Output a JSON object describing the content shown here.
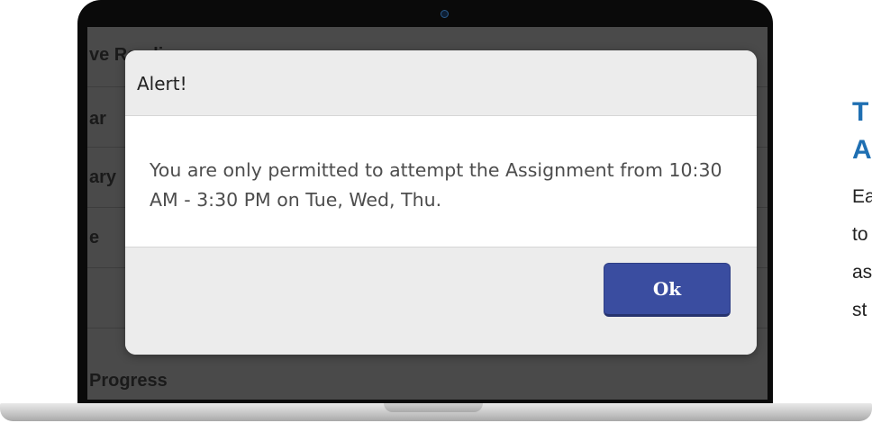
{
  "background_screen": {
    "rows": [
      "ve Readin",
      "ar",
      "ary",
      "e",
      "",
      "Progress"
    ]
  },
  "dialog": {
    "title": "Alert!",
    "message": "You are only permitted to attempt the Assignment from 10:30 AM - 3:30 PM on Tue, Wed, Thu.",
    "ok_label": "Ok"
  },
  "side_panel": {
    "heading_line1": "T",
    "heading_line2": "A",
    "text_lines": [
      "Ea",
      "to",
      "as",
      "st"
    ]
  },
  "colors": {
    "accent": "#3a4da0",
    "heading": "#1f6fb2",
    "dialog_chrome": "#ececec",
    "screen_bg": "#4a4a4a"
  }
}
